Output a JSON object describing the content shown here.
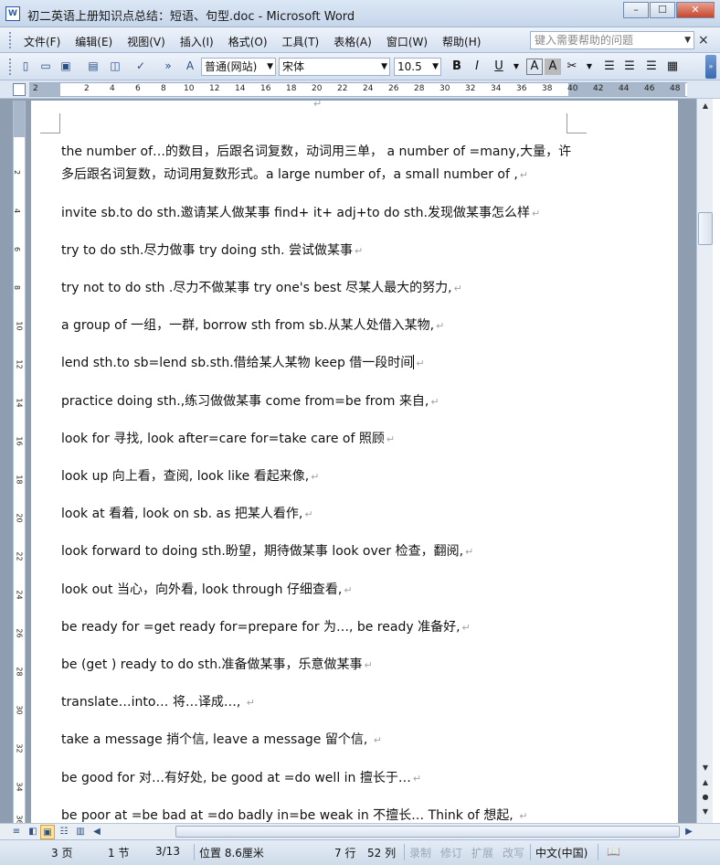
{
  "window": {
    "title": "初二英语上册知识点总结：短语、句型.doc - Microsoft Word",
    "icon": "W",
    "min_glyph": "–",
    "max_glyph": "☐",
    "close_glyph": "✕"
  },
  "menu": {
    "items": [
      "文件(F)",
      "编辑(E)",
      "视图(V)",
      "插入(I)",
      "格式(O)",
      "工具(T)",
      "表格(A)",
      "窗口(W)",
      "帮助(H)"
    ],
    "help_placeholder": "键入需要帮助的问题",
    "close_glyph": "×"
  },
  "toolbar": {
    "style": "普通(网站)",
    "font": "宋体",
    "size": "10.5",
    "bold": "B",
    "italic": "I",
    "underline": "U",
    "font_color_glyph": "A",
    "highlight_glyph": "A"
  },
  "ruler": {
    "numbers": [
      "2",
      "2",
      "4",
      "6",
      "8",
      "10",
      "12",
      "14",
      "16",
      "18",
      "20",
      "22",
      "24",
      "26",
      "28",
      "30",
      "32",
      "34",
      "36",
      "38",
      "40",
      "42",
      "44",
      "46",
      "48"
    ],
    "vnumbers": [
      "2",
      "4",
      "6",
      "8",
      "10",
      "12",
      "14",
      "16",
      "18",
      "20",
      "22",
      "24",
      "26",
      "28",
      "30",
      "32",
      "34",
      "36"
    ]
  },
  "document": {
    "lines": [
      {
        "text": "the number of…的数目，后跟名词复数，动词用三单， a number of =many,大量，许"
      },
      {
        "text": "多后跟名词复数，动词用复数形式。a large number of，a small number of ,"
      },
      {
        "text": "invite sb.to do sth.邀请某人做某事    find+ it+ adj+to do sth.发现做某事怎么样"
      },
      {
        "text": "try to do sth.尽力做事                try doing sth. 尝试做某事"
      },
      {
        "text": "try not to do sth .尽力不做某事            try one's best 尽某人最大的努力,"
      },
      {
        "text": "a group of 一组，一群,            borrow sth from sb.从某人处借入某物,"
      },
      {
        "text": "lend sth.to sb=lend sb.sth.借给某人某物          keep 借一段时间"
      },
      {
        "text": "practice doing sth.,练习做做某事            come from=be from 来自,"
      },
      {
        "text": "look for 寻找,                  look after=care for=take care of 照顾"
      },
      {
        "text": "look up 向上看，查阅,              look like 看起来像,"
      },
      {
        "text": "look at 看着,                       look on sb. as 把某人看作,"
      },
      {
        "text": "look forward to doing sth.盼望，期待做某事          look over 检查，翻阅,"
      },
      {
        "text": "look out 当心，向外看,             look through 仔细查看,"
      },
      {
        "text": "be ready for =get ready for=prepare for 为…,          be ready 准备好,"
      },
      {
        "text": "be (get ) ready to do sth.准备做某事，乐意做某事"
      },
      {
        "text": "translate…into… 将…译成…, "
      },
      {
        "text": "take a message 捎个信,              leave a message 留个信, "
      },
      {
        "text": "be good for 对…有好处,             be good at =do well in 擅长于…"
      },
      {
        "text": "be poor at =be bad at =do badly in=be weak in 不擅长…   Think of 想起, "
      }
    ],
    "paragraph_mark": "↵"
  },
  "status": {
    "page": "3 页",
    "section": "1 节",
    "page_of": "3/13",
    "position": "位置 8.6厘米",
    "line": "7 行",
    "col": "52 列",
    "rec": "录制",
    "trk": "修订",
    "ext": "扩展",
    "ovr": "改写",
    "lang": "中文(中国)"
  }
}
